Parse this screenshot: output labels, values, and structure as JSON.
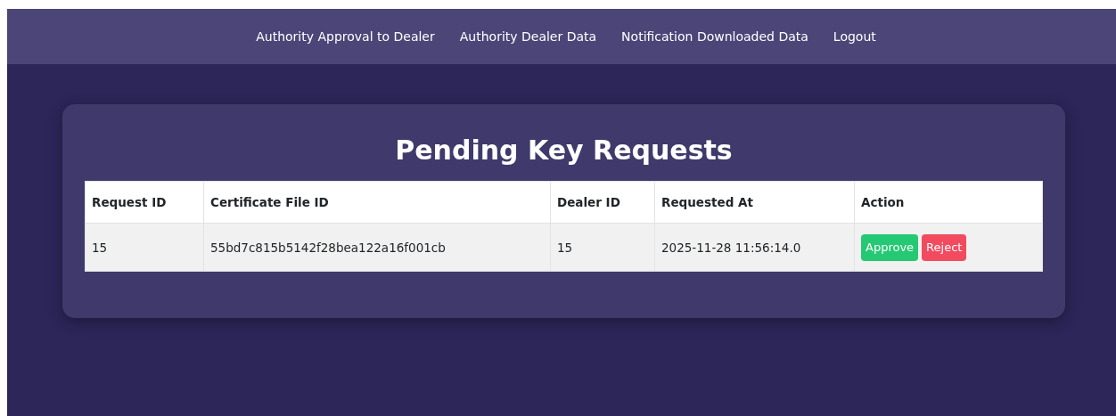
{
  "nav": {
    "links": [
      "Authority Approval to Dealer",
      "Authority Dealer Data",
      "Notification Downloaded Data",
      "Logout"
    ]
  },
  "panel": {
    "title": "Pending Key Requests",
    "table": {
      "columns": [
        "Request ID",
        "Certificate File ID",
        "Dealer ID",
        "Requested At",
        "Action"
      ],
      "rows": [
        {
          "cells": [
            "15",
            "55bd7c815b5142f28bea122a16f001cb",
            "15",
            "2025-11-28 11:56:14.0"
          ],
          "actions": [
            {
              "label": "Approve",
              "kind": "approve"
            },
            {
              "label": "Reject",
              "kind": "reject"
            }
          ]
        }
      ]
    }
  }
}
